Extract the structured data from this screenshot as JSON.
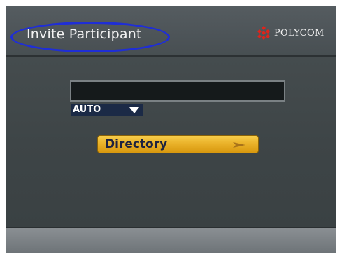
{
  "header": {
    "title": "Invite Participant",
    "brand": "POLYCOM"
  },
  "dial": {
    "number_value": "",
    "speed_selected": "AUTO"
  },
  "actions": {
    "directory_label": "Directory"
  },
  "icons": {
    "logo": "polycom-logo-icon",
    "dropdown": "triangle-down-icon",
    "directory": "arrow-right-icon"
  },
  "colors": {
    "accent_button": "#eab22a",
    "annotation_ellipse": "#1f2ed6",
    "speed_select_bg": "#1b2a46"
  }
}
